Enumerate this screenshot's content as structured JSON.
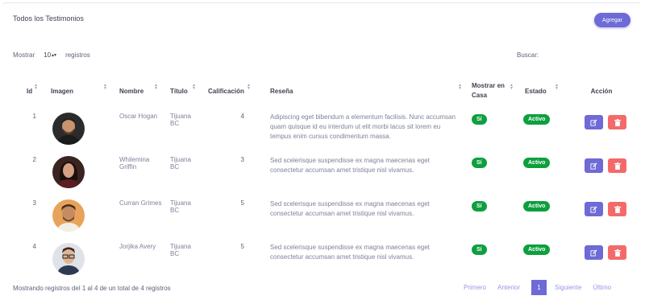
{
  "header": {
    "title": "Todos los Testimonios",
    "add_label": "Agregar"
  },
  "controls": {
    "show_label": "Mostrar",
    "page_size": "10",
    "records_label": "registros",
    "search_label": "Buscar:"
  },
  "table": {
    "columns": [
      "Id",
      "Imagen",
      "Nombre",
      "Título",
      "Calificación",
      "Reseña",
      "Mostrar en Casa",
      "Estado",
      "Acción"
    ],
    "rows": [
      {
        "id": "1",
        "name": "Oscar Hogan",
        "title": "Tijuana BC",
        "rating": "4",
        "review": "Adipiscing eget bibendum a elementum facilisis. Nunc accumsan quam quisque id eu interdum ut elit morbi lacus sit lorem eu tempus enim cursus condimentum massa.",
        "home": "Sí",
        "status": "Activo"
      },
      {
        "id": "2",
        "name": "Whilemina Griffin",
        "title": "Tijuana BC",
        "rating": "3",
        "review": "Sed scelerisque suspendisse ex magna maecenas eget consectetur accumsan amet tristique nisl vivamus.",
        "home": "Sí",
        "status": "Activo"
      },
      {
        "id": "3",
        "name": "Curran Grimes",
        "title": "Tijuana BC",
        "rating": "5",
        "review": "Sed scelerisque suspendisse ex magna maecenas eget consectetur accumsan amet tristique nisl vivamus.",
        "home": "Sí",
        "status": "Activo"
      },
      {
        "id": "4",
        "name": "Jorjika Avery",
        "title": "Tijuana BC",
        "rating": "5",
        "review": "Sed scelerisque suspendisse ex magna maecenas eget consectetur accumsan amet tristique nisl vivamus.",
        "home": "Sí",
        "status": "Activo"
      }
    ]
  },
  "footer": {
    "info": "Mostrando registros del 1 al 4 de un total de 4 registros",
    "first": "Primero",
    "prev": "Anterior",
    "current": "1",
    "next": "Siguiente",
    "last": "Último"
  },
  "icons": {
    "edit": "edit-icon",
    "delete": "trash-icon",
    "sort": "sort-icon"
  },
  "colors": {
    "primary": "#6e6ad6",
    "success": "#0e9f3e",
    "danger": "#f46a6a"
  }
}
